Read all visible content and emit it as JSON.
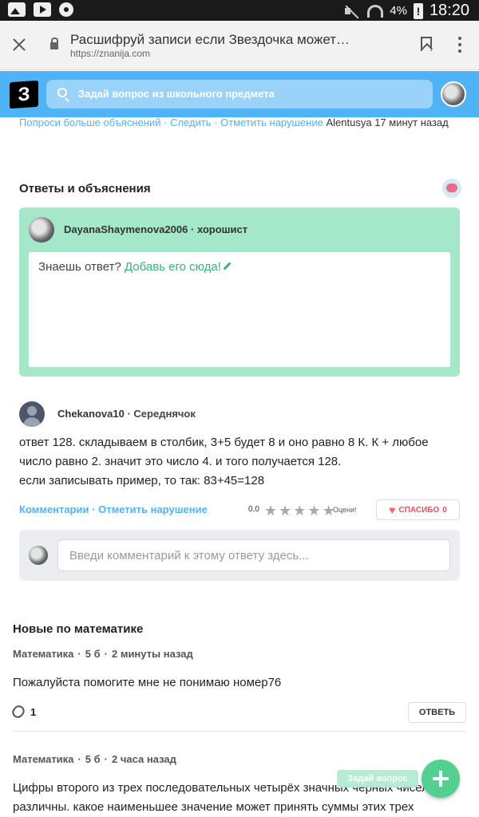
{
  "status_bar": {
    "battery": "4%",
    "time": "18:20"
  },
  "browser": {
    "title": "Расшифруй записи если Звездочка может…",
    "url": "https://znanija.com"
  },
  "site": {
    "logo": "З",
    "search_placeholder": "Задай вопрос из школьного предмета"
  },
  "question_meta": {
    "more_link": "Попроси больше объяснений",
    "follow_link": "Следить",
    "report_link": "Отметить нарушение",
    "user": "Alentusya",
    "time": "17 минут назад"
  },
  "answers": {
    "title": "Ответы и объяснения",
    "current_user": "DayanaShaymenova2006",
    "current_rank": "хорошист",
    "prompt_text": "Знаешь ответ?",
    "prompt_link": "Добавь его сюда!"
  },
  "answer": {
    "user": "Chekanova10",
    "rank": "Середнячок",
    "text_line1": "ответ 128. складываем в столбик, 3+5 будет 8 и оно равно 8 К. К + любое число равно 2. значит это число 4. и того получается 128.",
    "text_line2": "если записывать пример, то так: 83+45=128",
    "comments_link": "Комментарии",
    "report_link": "Отметить нарушение",
    "rating": "0,0",
    "rate_label": "Оцени!",
    "thanks_label": "СПАСИБО",
    "thanks_count": "0",
    "comment_placeholder": "Введи комментарий к этому ответу здесь..."
  },
  "new_questions": {
    "title": "Новые по математике",
    "items": [
      {
        "subject": "Математика",
        "points": "5 б",
        "time": "2 минуты назад",
        "text": "Пожалуйста помогите мне не понимаю номер76",
        "attachments": "1",
        "answer_label": "ОТВЕТЬ"
      },
      {
        "subject": "Математика",
        "points": "5 б",
        "time": "2 часа назад",
        "text": "Цифры второго из трех последовательных четырёх значных черных чисел различны. какое наименьшее значение может принять суммы этих трех"
      }
    ]
  },
  "floating": {
    "ask_label": "Задай вопрос"
  }
}
